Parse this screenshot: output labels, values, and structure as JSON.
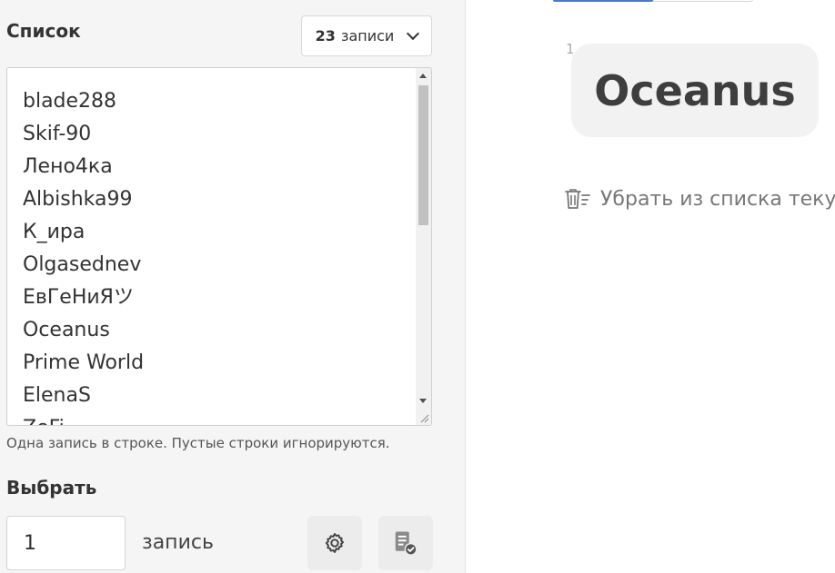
{
  "list_section": {
    "title": "Список",
    "count_dropdown": {
      "number": "23",
      "unit": "записи"
    },
    "entries": [
      "blade288",
      "Skif-90",
      "Лено4ка",
      "Albishka99",
      "К_ира",
      "Olgasednev",
      "ЕвГеНиЯツ",
      "Oceanus",
      "Prime World",
      "ElenaS",
      "ZeFi"
    ],
    "hint": "Одна запись в строке. Пустые строки игнорируются."
  },
  "pick_section": {
    "title": "Выбрать",
    "quantity_value": "1",
    "unit_label": "запись"
  },
  "result": {
    "index": "1",
    "winner": "Oceanus",
    "remove_label": "Убрать из списка текущ"
  }
}
